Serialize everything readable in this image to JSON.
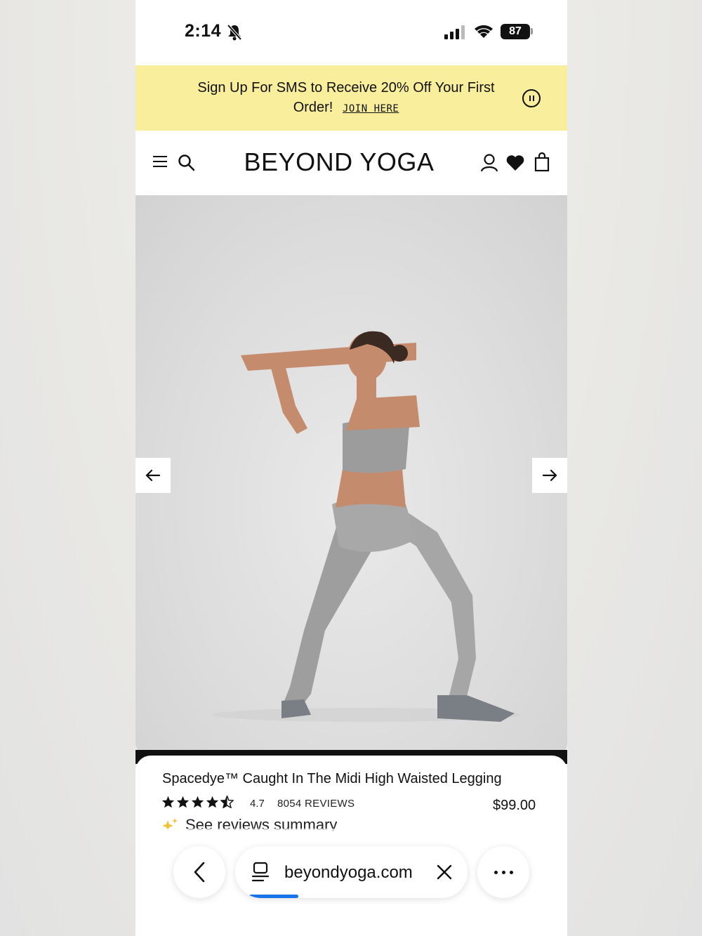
{
  "status_bar": {
    "time": "2:14",
    "battery": "87"
  },
  "promo": {
    "text": "Sign Up For SMS to Receive 20% Off Your First Order!",
    "link": "JOIN HERE"
  },
  "header": {
    "logo": "BEYOND YOGA"
  },
  "product": {
    "title": "Spacedye™ Caught In The Midi High Waisted Legging",
    "rating": "4.7",
    "rating_value": 4.5,
    "reviews": "8054 REVIEWS",
    "price": "$99.00",
    "summary_link": "See reviews summary"
  },
  "browser": {
    "url": "beyondyoga.com",
    "load_progress": 0.2
  },
  "colors": {
    "promo_bg": "#f8ee9b",
    "progress": "#1a73e8"
  }
}
